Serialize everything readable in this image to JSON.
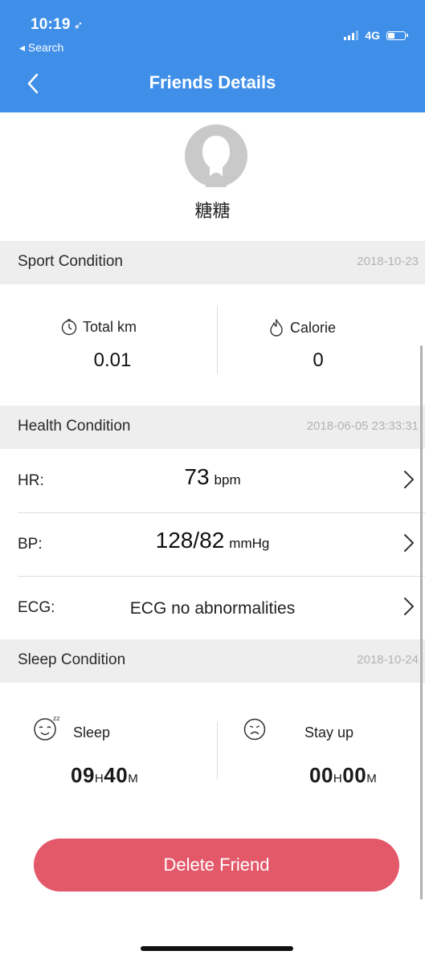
{
  "status_bar": {
    "time": "10:19",
    "back_app": "◂ Search",
    "network": "4G"
  },
  "header": {
    "title": "Friends Details"
  },
  "profile": {
    "name": "糖糖"
  },
  "sport": {
    "title": "Sport Condition",
    "date": "2018-10-23",
    "total_km_label": "Total km",
    "total_km_value": "0.01",
    "calorie_label": "Calorie",
    "calorie_value": "0"
  },
  "health": {
    "title": "Health Condition",
    "date": "2018-06-05 23:33:31",
    "hr_label": "HR:",
    "hr_value": "73",
    "hr_unit": "bpm",
    "bp_label": "BP:",
    "bp_value": "128/82",
    "bp_unit": "mmHg",
    "ecg_label": "ECG:",
    "ecg_value": "ECG no abnormalities"
  },
  "sleep": {
    "title": "Sleep Condition",
    "date": "2018-10-24",
    "sleep_label": "Sleep",
    "sleep_hours": "09",
    "sleep_h_unit": "H",
    "sleep_minutes": "40",
    "sleep_m_unit": "M",
    "stayup_label": "Stay up",
    "stayup_hours": "00",
    "stayup_h_unit": "H",
    "stayup_minutes": "00",
    "stayup_m_unit": "M"
  },
  "actions": {
    "delete_label": "Delete Friend"
  },
  "colors": {
    "header_blue": "#3f8fe9",
    "delete_red": "#e3596a",
    "section_bg": "#eeeeee",
    "date_gray": "#b3b3b3"
  },
  "icons": {
    "back": "chevron-left-icon",
    "avatar": "default-avatar-icon",
    "total_km": "stopwatch-icon",
    "calorie": "flame-icon",
    "row_arrow": "chevron-right-icon",
    "sleep": "sleeping-face-icon",
    "stay_up": "sad-face-icon"
  }
}
